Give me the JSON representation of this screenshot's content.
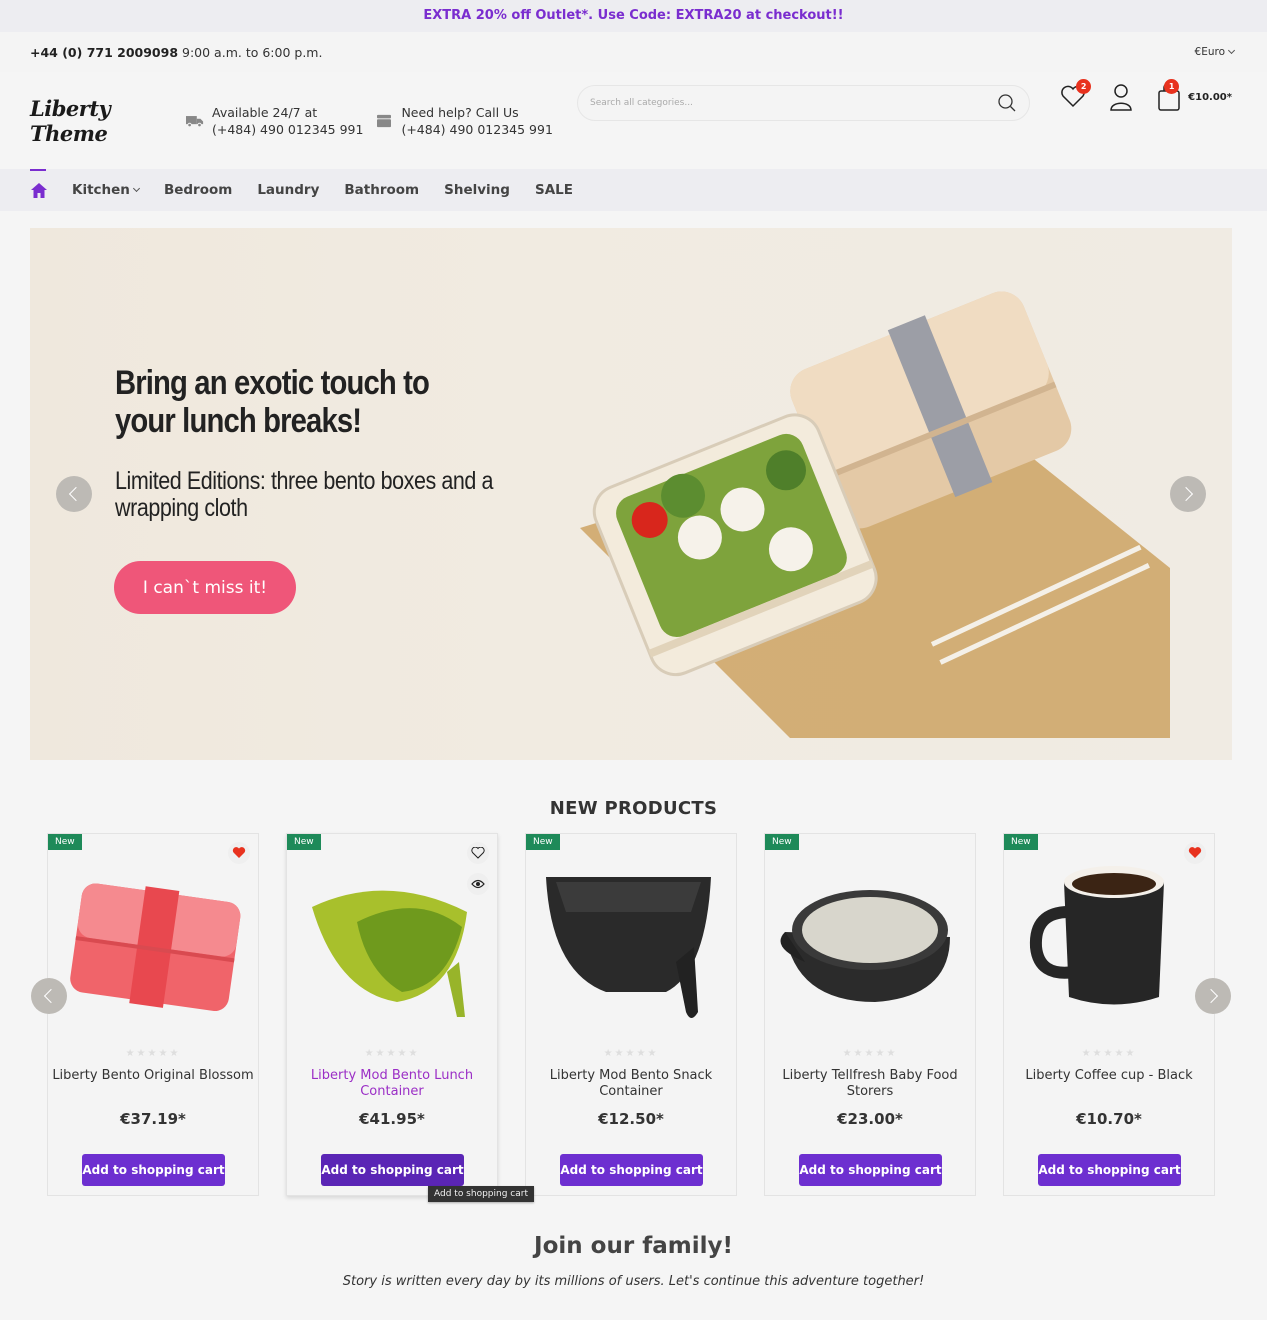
{
  "promo": {
    "text": "EXTRA 20% off Outlet*. Use Code: EXTRA20 at checkout!!"
  },
  "topbar": {
    "phone": "+44 (0) 771 2009098",
    "hours": "9:00 a.m. to 6:00 p.m.",
    "currency": "€Euro"
  },
  "header": {
    "logo": "Liberty Theme",
    "info": [
      {
        "icon": "truck-icon",
        "line1": "Available 24/7 at",
        "line2": "(+484) 490 012345 991"
      },
      {
        "icon": "box-icon",
        "line1": "Need help? Call Us",
        "line2": "(+484) 490 012345 991"
      }
    ],
    "search": {
      "placeholder": "Search all categories..."
    },
    "wishlist_count": "2",
    "cart_count": "1",
    "cart_total": "€10.00*"
  },
  "nav": {
    "items": [
      {
        "label": "Kitchen",
        "dropdown": true
      },
      {
        "label": "Bedroom"
      },
      {
        "label": "Laundry"
      },
      {
        "label": "Bathroom"
      },
      {
        "label": "Shelving"
      },
      {
        "label": "SALE"
      }
    ]
  },
  "hero": {
    "title": "Bring an exotic touch to your lunch breaks!",
    "subtitle": "Limited Editions: three bento boxes and a wrapping cloth",
    "cta": "I can`t miss it!",
    "accent": "#ef5679"
  },
  "products": {
    "title": "NEW PRODUCTS",
    "badge": "New",
    "add_label": "Add to shopping cart",
    "items": [
      {
        "name": "Liberty Bento Original Blossom",
        "price": "€37.19*",
        "wishlisted": true,
        "rating": 0
      },
      {
        "name": "Liberty Mod Bento Lunch Container",
        "price": "€41.95*",
        "wishlisted": false,
        "rating": 0
      },
      {
        "name": "Liberty Mod Bento Snack Container",
        "price": "€12.50*",
        "wishlisted": false,
        "rating": 0
      },
      {
        "name": "Liberty Tellfresh Baby Food Storers",
        "price": "€23.00*",
        "wishlisted": false,
        "rating": 0
      },
      {
        "name": "Liberty Coffee cup - Black",
        "price": "€10.70*",
        "wishlisted": true,
        "rating": 0
      }
    ],
    "tooltip": "Add to shopping cart"
  },
  "join": {
    "title": "Join our family!",
    "subtitle": "Story is written every day by its millions of users. Let's continue this adventure together!"
  },
  "colors": {
    "brand": "#7a2dcf",
    "button": "#6d2fd0",
    "badge_new": "#1e8a59",
    "alert": "#e8321e"
  }
}
